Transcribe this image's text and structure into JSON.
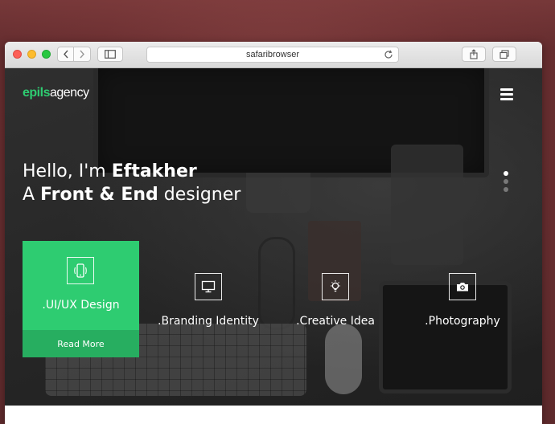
{
  "browser": {
    "address": "safaribrowser",
    "new_tab_symbol": "+"
  },
  "site": {
    "logo": {
      "part1": "epils",
      "part2": "agency"
    },
    "headline": {
      "line1_prefix": "Hello, I'm ",
      "line1_bold": "Eftakher",
      "line2_prefix": "A ",
      "line2_bold": "Front & End",
      "line2_suffix": " designer"
    },
    "slider_dots": 3,
    "slider_active_index": 0,
    "services": [
      {
        "label": ".UI/UX Design",
        "icon": "mobile-icon",
        "action": "Read More",
        "highlighted": true
      },
      {
        "label": ".Branding Identity",
        "icon": "monitor-icon"
      },
      {
        "label": ".Creative Idea",
        "icon": "lightbulb-icon"
      },
      {
        "label": ".Photography",
        "icon": "camera-icon"
      }
    ]
  },
  "colors": {
    "accent": "#2ecc71",
    "accent_dark": "#27ae60",
    "backdrop": "#6b2f31"
  }
}
